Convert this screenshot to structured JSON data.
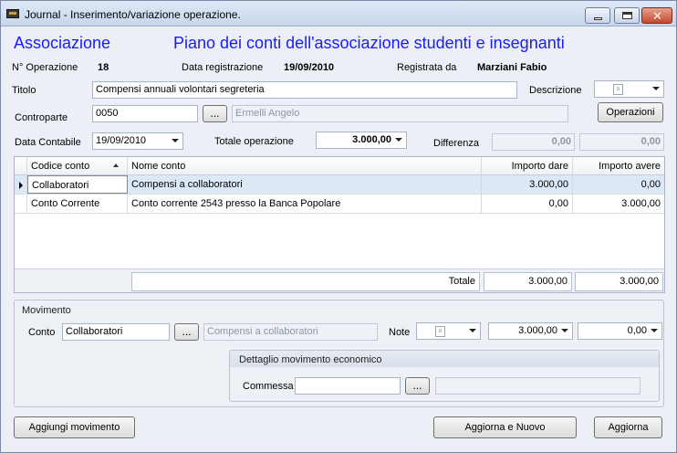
{
  "window": {
    "title": "Journal - Inserimento/variazione operazione."
  },
  "header": {
    "left_title": "Associazione",
    "right_title": "Piano dei conti dell'associazione studenti e insegnanti"
  },
  "info": {
    "operazione_label": "N° Operazione",
    "operazione_value": "18",
    "data_reg_label": "Data registrazione",
    "data_reg_value": "19/09/2010",
    "registrata_label": "Registrata da",
    "registrata_value": "Marziani Fabio"
  },
  "form": {
    "titolo_label": "Titolo",
    "titolo_value": "Compensi annuali volontari segreteria",
    "descrizione_label": "Descrizione",
    "controparte_label": "Controparte",
    "controparte_code": "0050",
    "controparte_name": "Ermelli Angelo",
    "ellipsis": "...",
    "operazioni_button": "Operazioni",
    "data_contabile_label": "Data Contabile",
    "data_contabile_value": "19/09/2010",
    "totale_label": "Totale operazione",
    "totale_value": "3.000,00",
    "differenza_label": "Differenza",
    "differenza_a": "0,00",
    "differenza_b": "0,00"
  },
  "grid": {
    "columns": [
      "Codice conto",
      "Nome conto",
      "Importo dare",
      "Importo avere"
    ],
    "rows": [
      {
        "codice": "Collaboratori",
        "nome": "Compensi a collaboratori",
        "dare": "3.000,00",
        "avere": "0,00"
      },
      {
        "codice": "Conto Corrente",
        "nome": "Conto corrente 2543 presso la Banca Popolare",
        "dare": "0,00",
        "avere": "3.000,00"
      }
    ],
    "totale_label": "Totale",
    "totale_dare": "3.000,00",
    "totale_avere": "3.000,00"
  },
  "movimento": {
    "title": "Movimento",
    "conto_label": "Conto",
    "conto_value": "Collaboratori",
    "conto_name": "Compensi a collaboratori",
    "note_label": "Note",
    "dare_value": "3.000,00",
    "avere_value": "0,00",
    "dettaglio_title": "Dettaglio movimento economico",
    "commessa_label": "Commessa"
  },
  "buttons": {
    "aggiungi": "Aggiungi movimento",
    "aggiorna_nuovo": "Aggiorna e Nuovo",
    "aggiorna": "Aggiorna"
  },
  "icons": {
    "app": "journal-app-icon",
    "doc": "document-icon"
  },
  "colors": {
    "header_blue": "#1a1aff",
    "selected_row": "#dde8f7"
  }
}
